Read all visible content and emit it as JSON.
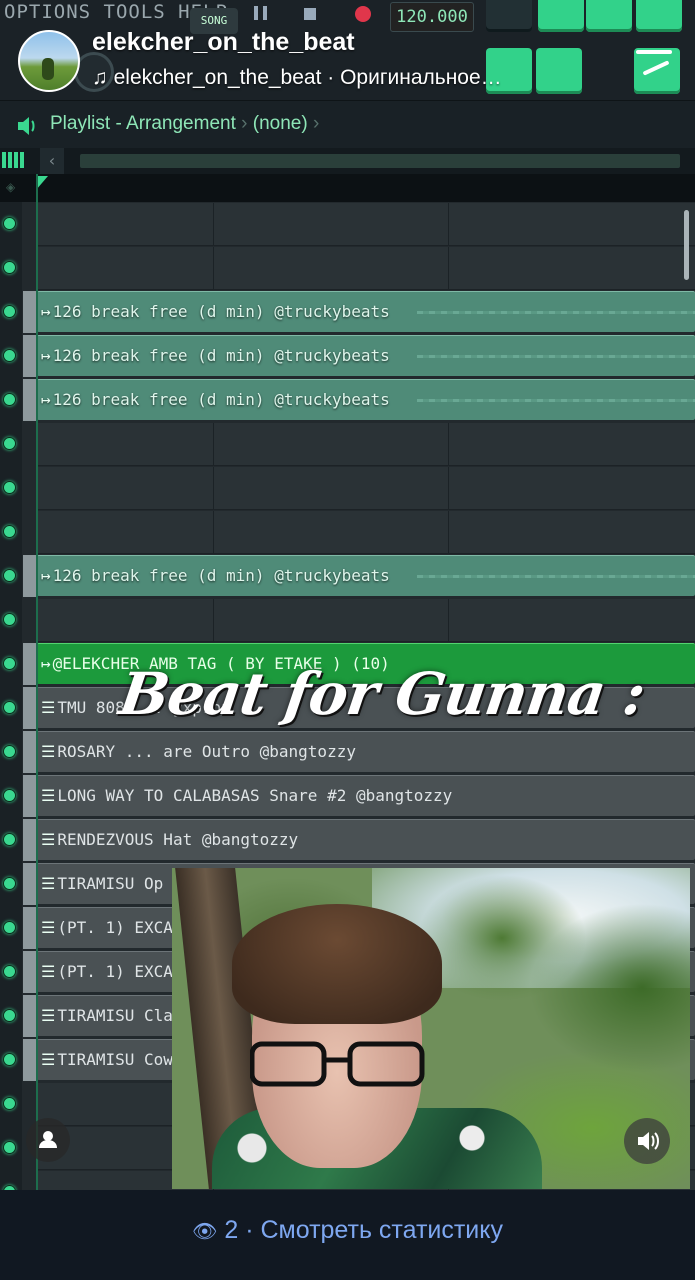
{
  "fl": {
    "menu": "OPTIONS TOOLS HELP",
    "song_label": "SONG",
    "tempo": "120.000"
  },
  "reel": {
    "username": "elekcher_on_the_beat",
    "audio_icon": "music-note-icon",
    "audio_text": "elekcher_on_the_beat · Оригинальное…"
  },
  "playlist": {
    "title": "Playlist - Arrangement",
    "pattern": "(none)"
  },
  "tracks": [
    {
      "label": ""
    },
    {
      "label": ""
    },
    {
      "label": "126 break free (d min) @truckybeats",
      "kind": "audio"
    },
    {
      "label": "126 break free (d min) @truckybeats",
      "kind": "audio"
    },
    {
      "label": "126 break free (d min) @truckybeats",
      "kind": "audio"
    },
    {
      "label": ""
    },
    {
      "label": ""
    },
    {
      "label": ""
    },
    {
      "label": "126 break free (d min) @truckybeats",
      "kind": "audio"
    },
    {
      "label": ""
    },
    {
      "label": "@ELEKCHER AMB TAG ( BY ETAKE ) (10)",
      "kind": "green"
    },
    {
      "label": "TMU 808 ... yxprou",
      "kind": "pattern"
    },
    {
      "label": "ROSARY ... are Outro @bangtozzy",
      "kind": "pattern"
    },
    {
      "label": "LONG WAY TO CALABASAS Snare #2 @bangtozzy",
      "kind": "pattern"
    },
    {
      "label": "RENDEZVOUS Hat @bangtozzy",
      "kind": "pattern"
    },
    {
      "label": "TIRAMISU Op Hat @bangtozzy",
      "kind": "pattern"
    },
    {
      "label": "(PT. 1) EXCAVA",
      "kind": "pattern"
    },
    {
      "label": "(PT. 1) EXCAVA",
      "kind": "pattern"
    },
    {
      "label": "TIRAMISU Clav",
      "kind": "pattern"
    },
    {
      "label": "TIRAMISU Cow",
      "kind": "pattern"
    },
    {
      "label": ""
    },
    {
      "label": ""
    },
    {
      "label": ""
    }
  ],
  "caption": "Beat for Gunna :",
  "icons": {
    "sound": "speaker-icon",
    "person": "person-icon",
    "views": "eye-icon"
  },
  "footer": {
    "views": "2",
    "stats_text": "Смотреть статистику"
  }
}
